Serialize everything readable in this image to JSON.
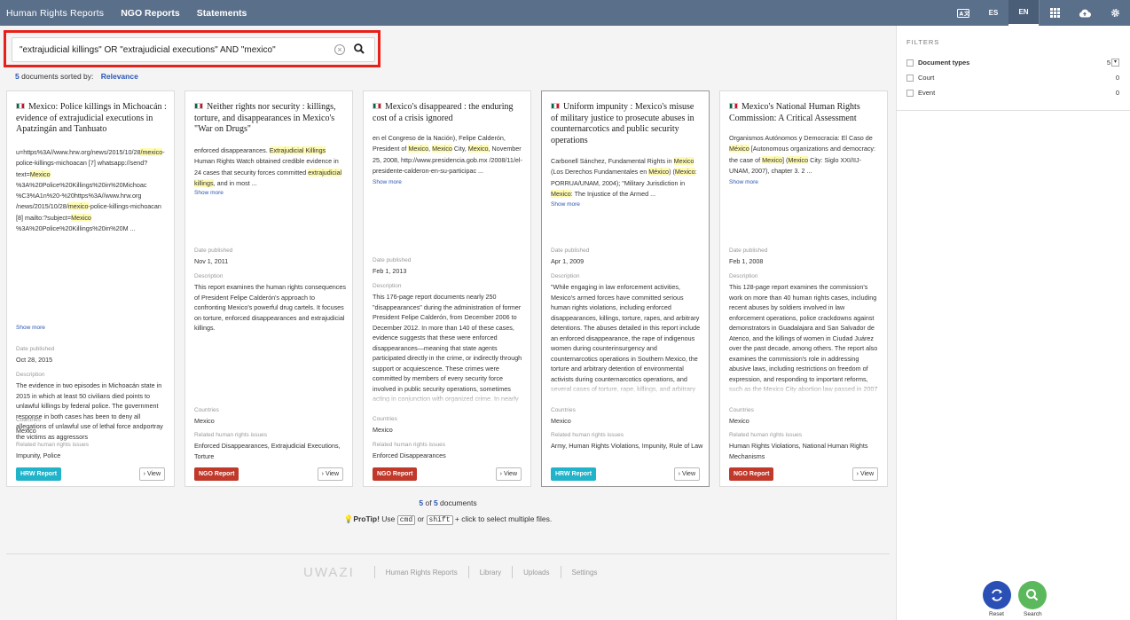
{
  "topbar": {
    "nav": [
      "Human Rights Reports",
      "NGO Reports",
      "Statements"
    ],
    "lang_icon": "translate-icon",
    "languages": [
      "ES",
      "EN"
    ],
    "active_language": "EN",
    "colors": {
      "bar": "#5a6f8a"
    }
  },
  "search": {
    "query": "\"extrajudicial killings\" OR \"extrajudicial executions\" AND \"mexico\"",
    "highlight_color": "#e8201a"
  },
  "sort": {
    "count": "5",
    "text": "documents sorted by:",
    "by": "Relevance"
  },
  "cards": [
    {
      "title": "Mexico: Police killings in Michoacán : evidence of extrajudicial executions in Apatzingán and Tanhuato",
      "snippet_html": "u=https%3A//www.hrw.org/news/2015/10/28<span class=\"hl\">/mexico</span>-police-killings-michoacan [7] whatsapp://send?text=<span class=\"hl\">Mexico</span> %3A%20Police%20Killings%20in%20Michoac %C3%A1n%20-%20https%3A//www.hrw.org /news/2015/10/28/<span class=\"hl\">mexico</span>-police-killings-michoacan [8] mailto:?subject=<span class=\"hl\">Mexico</span> %3A%20Police%20Killings%20in%20M ...",
      "show_more": "Show more",
      "date_label": "Date published",
      "date": "Oct 28, 2015",
      "desc_label": "Description",
      "description": "The evidence in two episodes in Michoacán state in 2015 in which at least 50 civilians died points to unlawful killings by federal police. The government response in both cases has been to deny all allegations of unlawful use of lethal force andportray the victims as aggressors",
      "countries_label": "Countries",
      "countries": "Mexico",
      "issues_label": "Related human rights issues",
      "issues": "Impunity, Police",
      "type": "HRW Report",
      "type_class": "hrw",
      "view": "View"
    },
    {
      "title": "Neither rights nor security : killings, torture, and disappearances in Mexico's \"War on Drugs\"",
      "snippet_html": "enforced disappearances. <span class=\"hl\">Extrajudicial Killings</span> Human Rights Watch obtained credible evidence in 24 cases that security forces committed <span class=\"hl\">extrajudicial killings</span>, and in most ...",
      "show_more": "Show more",
      "date_label": "Date published",
      "date": "Nov 1, 2011",
      "desc_label": "Description",
      "description": "This report examines the human rights consequences of President Felipe Calderón's approach to confronting Mexico's powerful drug cartels. It focuses on torture, enforced disappearances and extrajudicial killings.",
      "countries_label": "Countries",
      "countries": "Mexico",
      "issues_label": "Related human rights issues",
      "issues": "Enforced Disappearances, Extrajudicial Executions, Torture",
      "type": "NGO Report",
      "type_class": "ngo",
      "view": "View"
    },
    {
      "title": "Mexico's disappeared : the enduring cost of a crisis ignored",
      "snippet_html": "en el Congreso de la Nación), Felipe Calderón, President of <span class=\"hl\">Mexico</span>, <span class=\"hl\">Mexico</span> City, <span class=\"hl\">Mexico</span>, November 25, 2008, http://www.presidencia.gob.mx /2008/11/el-presidente-calderon-en-su-participac ...",
      "show_more": "Show more",
      "date_label": "Date published",
      "date": "Feb 1, 2013",
      "desc_label": "Description",
      "description": "This 176-page report documents nearly 250 \"disappearances\" during the administration of former President Felipe Calderón, from December 2006 to December 2012. In more than 140 of these cases, evidence suggests that these were enforced disappearances—meaning that state agents participated directly in the crime, or indirectly through support or acquiescence. These crimes were committed by members of every security force involved in public security operations, sometimes acting in conjunction with organized crime. In nearly all of these cases, authorities failed",
      "countries_label": "Countries",
      "countries": "Mexico",
      "issues_label": "Related human rights issues",
      "issues": "Enforced Disappearances",
      "type": "NGO Report",
      "type_class": "ngo",
      "view": "View"
    },
    {
      "title": "Uniform impunity : Mexico's misuse of military justice to prosecute abuses in counternarcotics and public security operations",
      "snippet_html": "Carbonell Sánchez, Fundamental Rights in <span class=\"hl\">Mexico</span> (Los Derechos Fundamentales en <span class=\"hl\">México</span>) (<span class=\"hl\">Mexico</span>: PORRUA/UNAM, 2004); \"Military Jurisdiction in <span class=\"hl\">Mexico</span>: The Injustice of the Armed ...",
      "show_more": "Show more",
      "date_label": "Date published",
      "date": "Apr 1, 2009",
      "desc_label": "Description",
      "description": "\"While engaging in law enforcement activities, Mexico's armed forces have committed serious human rights violations, including enforced disappearances, killings, torture, rapes, and arbitrary detentions. The abuses detailed in this report include an enforced disappearance, the rape of indigenous women during counterinsurgency and counternarcotics operations in Southern Mexico, the torture and arbitrary detention of environmental activists during counternarcotics operations, and several cases of torture, rape, killings, and arbitrary detentions of dozens of people during public",
      "countries_label": "Countries",
      "countries": "Mexico",
      "issues_label": "Related human rights issues",
      "issues": "Army, Human Rights Violations, Impunity, Rule of Law",
      "type": "HRW Report",
      "type_class": "hrw",
      "view": "View"
    },
    {
      "title": "Mexico's National Human Rights Commission: A Critical Assessment",
      "snippet_html": "Organismos Autónomos y Democracia: El Caso de <span class=\"hl\">México</span> [Autonomous organizations and democracy: the case of <span class=\"hl\">Mexico</span>] (<span class=\"hl\">Mexico</span> City: Siglo XXI/IIJ-UNAM, 2007), chapter 3. 2 ...",
      "show_more": "Show more",
      "date_label": "Date published",
      "date": "Feb 1, 2008",
      "desc_label": "Description",
      "description": "This 128-page report examines the commission's work on more than 40 human rights cases, including recent abuses by soldiers involved in law enforcement operations, police crackdowns against demonstrators in Guadalajara and San Salvador de Atenco, and the killings of women in Ciudad Juárez over the past decade, among others. The report also examines the commission's role in addressing abusive laws, including restrictions on freedom of expression, and responding to important reforms, such as the Mexico City abortion law passed in 2007",
      "countries_label": "Countries",
      "countries": "Mexico",
      "issues_label": "Related human rights issues",
      "issues": "Human Rights Violations, National Human Rights Mechanisms",
      "type": "NGO Report",
      "type_class": "ngo",
      "view": "View"
    }
  ],
  "results": {
    "shown": "5",
    "of": "of",
    "total": "5",
    "label": "documents"
  },
  "protip": {
    "lead": "ProTip!",
    "use": "Use",
    "key1": "cmd",
    "or": "or",
    "key2": "shift",
    "tail": "+ click to select multiple files."
  },
  "footer": {
    "logo": "UWAZI",
    "links": [
      "Human Rights Reports",
      "Library",
      "Uploads",
      "Settings"
    ]
  },
  "filters": {
    "heading": "FILTERS",
    "items": [
      {
        "label": "Document types",
        "count": "5",
        "bold": true
      },
      {
        "label": "Court",
        "count": "0"
      },
      {
        "label": "Event",
        "count": "0"
      }
    ]
  },
  "actions": {
    "reset": "Reset",
    "search": "Search"
  }
}
